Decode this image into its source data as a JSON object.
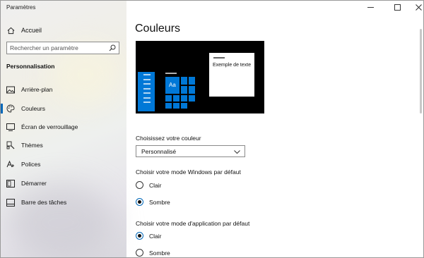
{
  "window": {
    "title": "Paramètres",
    "controls": {
      "minimize": "—",
      "maximize": "☐",
      "close": "✕"
    }
  },
  "sidebar": {
    "home_label": "Accueil",
    "search_placeholder": "Rechercher un paramètre",
    "section_title": "Personnalisation",
    "items": [
      {
        "label": "Arrière-plan",
        "icon": "image-icon"
      },
      {
        "label": "Couleurs",
        "icon": "palette-icon",
        "active": true
      },
      {
        "label": "Écran de verrouillage",
        "icon": "lock-screen-icon"
      },
      {
        "label": "Thèmes",
        "icon": "brush-icon"
      },
      {
        "label": "Polices",
        "icon": "font-icon"
      },
      {
        "label": "Démarrer",
        "icon": "start-icon"
      },
      {
        "label": "Barre des tâches",
        "icon": "taskbar-icon"
      }
    ]
  },
  "main": {
    "title": "Couleurs",
    "preview": {
      "tile_text": "Aa",
      "sample_text": "Exemple de texte",
      "accent_color": "#0078d7"
    },
    "color_choice": {
      "label": "Choisissez votre couleur",
      "selected": "Personnalisé"
    },
    "windows_mode": {
      "label": "Choisir votre mode Windows par défaut",
      "options": [
        {
          "label": "Clair",
          "checked": false
        },
        {
          "label": "Sombre",
          "checked": true
        }
      ]
    },
    "app_mode": {
      "label": "Choisir votre mode d'application par défaut",
      "options": [
        {
          "label": "Clair",
          "checked": true
        },
        {
          "label": "Sombre",
          "checked": false
        }
      ]
    }
  },
  "colors": {
    "accent": "#0078d7",
    "active_indicator": "#0067b8"
  }
}
